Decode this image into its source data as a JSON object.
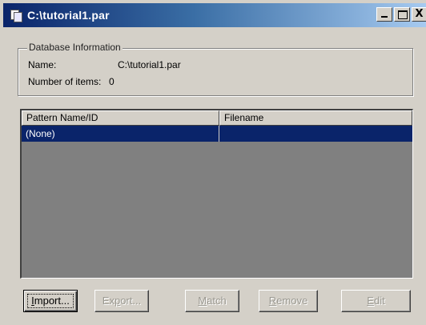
{
  "window": {
    "title": "C:\\tutorial1.par"
  },
  "title_buttons": {
    "minimize_icon": "minimize-icon",
    "maximize_icon": "maximize-icon",
    "close_glyph": "X"
  },
  "database_info": {
    "legend": "Database Information",
    "name_label": "Name:",
    "name_value": "C:\\tutorial1.par",
    "items_label": "Number of items:",
    "items_value": "0"
  },
  "list": {
    "columns": [
      "Pattern Name/ID",
      "Filename"
    ],
    "rows": [
      {
        "pattern": "(None)",
        "filename": "",
        "selected": true
      }
    ]
  },
  "buttons": {
    "import": {
      "mnemonic": "I",
      "rest": "mport...",
      "enabled": true
    },
    "export": {
      "pre": "Ex",
      "mnemonic": "p",
      "rest": "ort...",
      "enabled": false
    },
    "match": {
      "mnemonic": "M",
      "rest": "atch",
      "enabled": false
    },
    "remove": {
      "mnemonic": "R",
      "rest": "emove",
      "enabled": false
    },
    "edit": {
      "mnemonic": "E",
      "rest": "dit",
      "enabled": false
    }
  },
  "colors": {
    "titlebar_start": "#0a246a",
    "titlebar_end": "#a6caf0",
    "selection": "#0a246a",
    "face": "#d4d0c8",
    "list_empty": "#808080"
  }
}
